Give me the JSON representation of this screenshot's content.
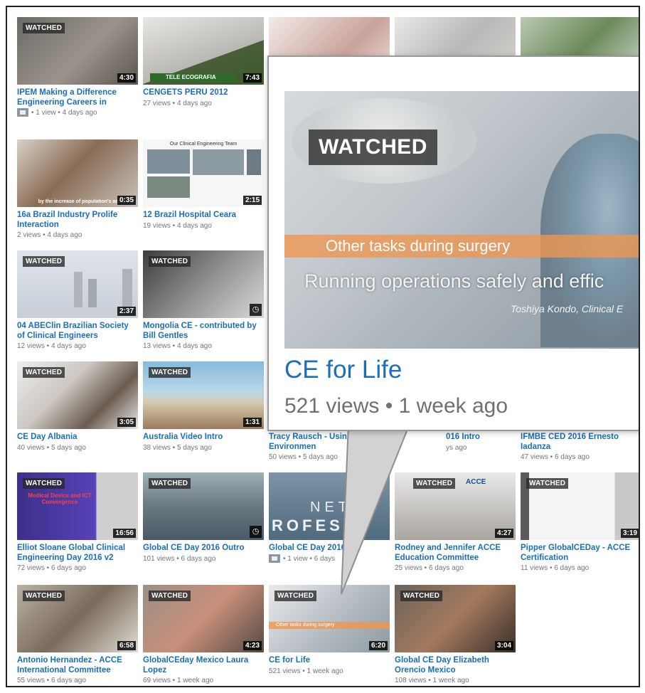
{
  "labels": {
    "watched": "WATCHED"
  },
  "videos": [
    {
      "title": "IPEM Making a Difference Engineering Careers in Medicine",
      "meta": "• 1 view • 4 days ago",
      "duration": "4:30",
      "watched": true,
      "badge": true
    },
    {
      "title": "CENGETS PERU 2012",
      "meta": "27 views • 4 days ago",
      "duration": "7:43",
      "watched": false
    },
    {
      "title": "16a Brazil Industry Prolife Interaction",
      "meta": "2 views • 4 days ago",
      "duration": "0:35",
      "watched": false
    },
    {
      "title": "12 Brazil Hospital Ceara",
      "meta": "19 views • 4 days ago",
      "duration": "2:15",
      "watched": false
    },
    {
      "title": "04 ABEClin Brazilian Society of Clinical Engineers",
      "meta": "12 views • 4 days ago",
      "duration": "2:37",
      "watched": true
    },
    {
      "title": "Mongolia CE - contributed by Bill Gentles",
      "meta": "13 views • 4 days ago",
      "duration": "",
      "watched": true,
      "clock": true
    },
    {
      "title": "CE Day Albania",
      "meta": "40 views • 5 days ago",
      "duration": "3:05",
      "watched": true
    },
    {
      "title": "Australia Video Intro",
      "meta": "38 views • 5 days ago",
      "duration": "1:31",
      "watched": true
    },
    {
      "title": "Tracy Rausch - Usin Clinical Environmen",
      "meta": "50 views • 5 days ago",
      "duration": "",
      "watched": false
    },
    {
      "title": "016 Intro",
      "meta": "ys ago",
      "duration": "",
      "watched": false
    },
    {
      "title": "IFMBE CED 2016 Ernesto Iadanza",
      "meta": "47 views • 6 days ago",
      "duration": "",
      "watched": false
    },
    {
      "title": "Elliot Sloane Global Clinical Engineering Day 2016 v2",
      "meta": "72 views • 6 days ago",
      "duration": "16:56",
      "watched": true
    },
    {
      "title": "Global CE Day 2016 Outro",
      "meta": "101 views • 6 days ago",
      "duration": "",
      "watched": true,
      "clock": true
    },
    {
      "title": "Global CE Day 2016",
      "meta": "• 1 view • 6 days",
      "duration": "",
      "watched": false,
      "badge": true
    },
    {
      "title": "Rodney and Jennifer ACCE Education Committee",
      "meta": "25 views • 6 days ago",
      "duration": "4:27",
      "watched": true
    },
    {
      "title": "Pipper GlobalCEDay - ACCE Certification",
      "meta": "11 views • 6 days ago",
      "duration": "3:19",
      "watched": true
    },
    {
      "title": "Antonio Hernandez - ACCE International Committee",
      "meta": "55 views • 6 days ago",
      "duration": "6:58",
      "watched": true
    },
    {
      "title": "GlobalCEday Mexico Laura Lopez",
      "meta": "69 views • 1 week ago",
      "duration": "4:23",
      "watched": true
    },
    {
      "title": "CE for Life",
      "meta": "521 views • 1 week ago",
      "duration": "6:20",
      "watched": true
    },
    {
      "title": "Global CE Day Elizabeth Orencio Mexico",
      "meta": "108 views • 1 week ago",
      "duration": "3:04",
      "watched": true
    }
  ],
  "popup": {
    "watched": "WATCHED",
    "band": "Other tasks during surgery",
    "subtitle": "Running operations safely and effic",
    "credit": "Toshiya Kondo, Clinical E",
    "title": "CE for Life",
    "meta": "521 views • 1 week ago"
  },
  "thumbs": {
    "slide_title": "Our Clinical Engineering Team",
    "purple_text": "Medical Device and ICT Convergence",
    "overlay_caption": "by the increase of population's acce",
    "tele_banner": "TELE ECOGRAFIA",
    "netw_text": "NETW",
    "rofes_text": "ROFES",
    "acce_logo": "ACCE"
  }
}
